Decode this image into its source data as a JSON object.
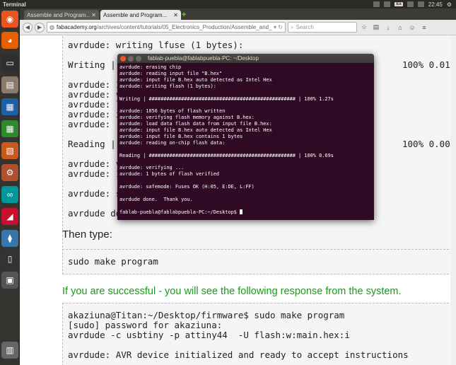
{
  "panel": {
    "app_name": "Terminal",
    "keyboard": "Es",
    "time": "22:45"
  },
  "launcher": {
    "items": [
      {
        "icon": "ubuntu-icon",
        "color": "#e95420"
      },
      {
        "icon": "firefox-icon",
        "color": "#e66000"
      },
      {
        "icon": "terminal-icon",
        "color": "#2e2e2e"
      },
      {
        "icon": "files-icon",
        "color": "#8a7b6b"
      },
      {
        "icon": "writer-icon",
        "color": "#1f5fa6"
      },
      {
        "icon": "calc-icon",
        "color": "#2f8a2f"
      },
      {
        "icon": "impress-icon",
        "color": "#c9591d"
      },
      {
        "icon": "settings-icon",
        "color": "#b05030"
      },
      {
        "icon": "arduino-icon",
        "color": "#00979c"
      },
      {
        "icon": "fab-icon",
        "color": "#c8102e"
      },
      {
        "icon": "python-icon",
        "color": "#3776ab"
      },
      {
        "icon": "usb-icon",
        "color": "#333333"
      },
      {
        "icon": "drive-icon",
        "color": "#555555"
      },
      {
        "icon": "trash-icon",
        "color": "#666666"
      }
    ]
  },
  "browser": {
    "tabs": [
      {
        "label": "Assemble and Program..."
      },
      {
        "label": "Assemble and Program..."
      }
    ],
    "url_host": "fabacademy.org",
    "url_path": "/archives/content/tutorials/05_Electronics_Production/Assemble_and_Pr",
    "search_placeholder": "Search"
  },
  "page": {
    "block1": [
      "avrdude: writing lfuse (1 bytes):",
      "",
      "Writing |",
      "",
      "avrdude: 1",
      "avrdude: v",
      "avrdude: l",
      "avrdude: i",
      "avrdude: r",
      "",
      "Reading |",
      "",
      "avrdude: v",
      "avrdude: 1",
      "",
      "avrdude: s",
      "",
      "avrdude do"
    ],
    "block1_right": [
      "100% 0.01s",
      "100% 0.00s"
    ],
    "then_type": "Then type:",
    "command": "sudo make program",
    "success_text": "If you are successful - you will see the following response from the system.",
    "block2": [
      "akaziuna@Titan:~/Desktop/firmware$ sudo make program",
      "[sudo] password for akaziuna:",
      "avrdude -c usbtiny -p attiny44  -U flash:w:main.hex:i",
      "",
      "avrdude: AVR device initialized and ready to accept instructions"
    ]
  },
  "terminal": {
    "title": "fablab-puebla@fablabpuebla-PC: ~/Desktop",
    "lines": [
      "avrdude: erasing chip",
      "avrdude: reading input file \"B.hex\"",
      "avrdude: input file B.hex auto detected as Intel Hex",
      "avrdude: writing flash (1 bytes):",
      "",
      "Writing | ################################################## | 100% 1.27s",
      "",
      "avrdude: 1056 bytes of flash written",
      "avrdude: verifying flash memory against B.hex:",
      "avrdude: load data flash data from input file B.hex:",
      "avrdude: input file B.hex auto detected as Intel Hex",
      "avrdude: input file B.hex contains 1 bytes",
      "avrdude: reading on-chip flash data:",
      "",
      "Reading | ################################################## | 100% 0.69s",
      "",
      "avrdude: verifying ...",
      "avrdude: 1 bytes of flash verified",
      "",
      "avrdude: safemode: Fuses OK (H:05, E:DE, L:FF)",
      "",
      "avrdude done.  Thank you.",
      "",
      "fablab-puebla@fablabpuebla-PC:~/Desktop$ "
    ]
  },
  "colors": {
    "success": "#1a9a1a",
    "terminal_bg": "#300a24"
  }
}
